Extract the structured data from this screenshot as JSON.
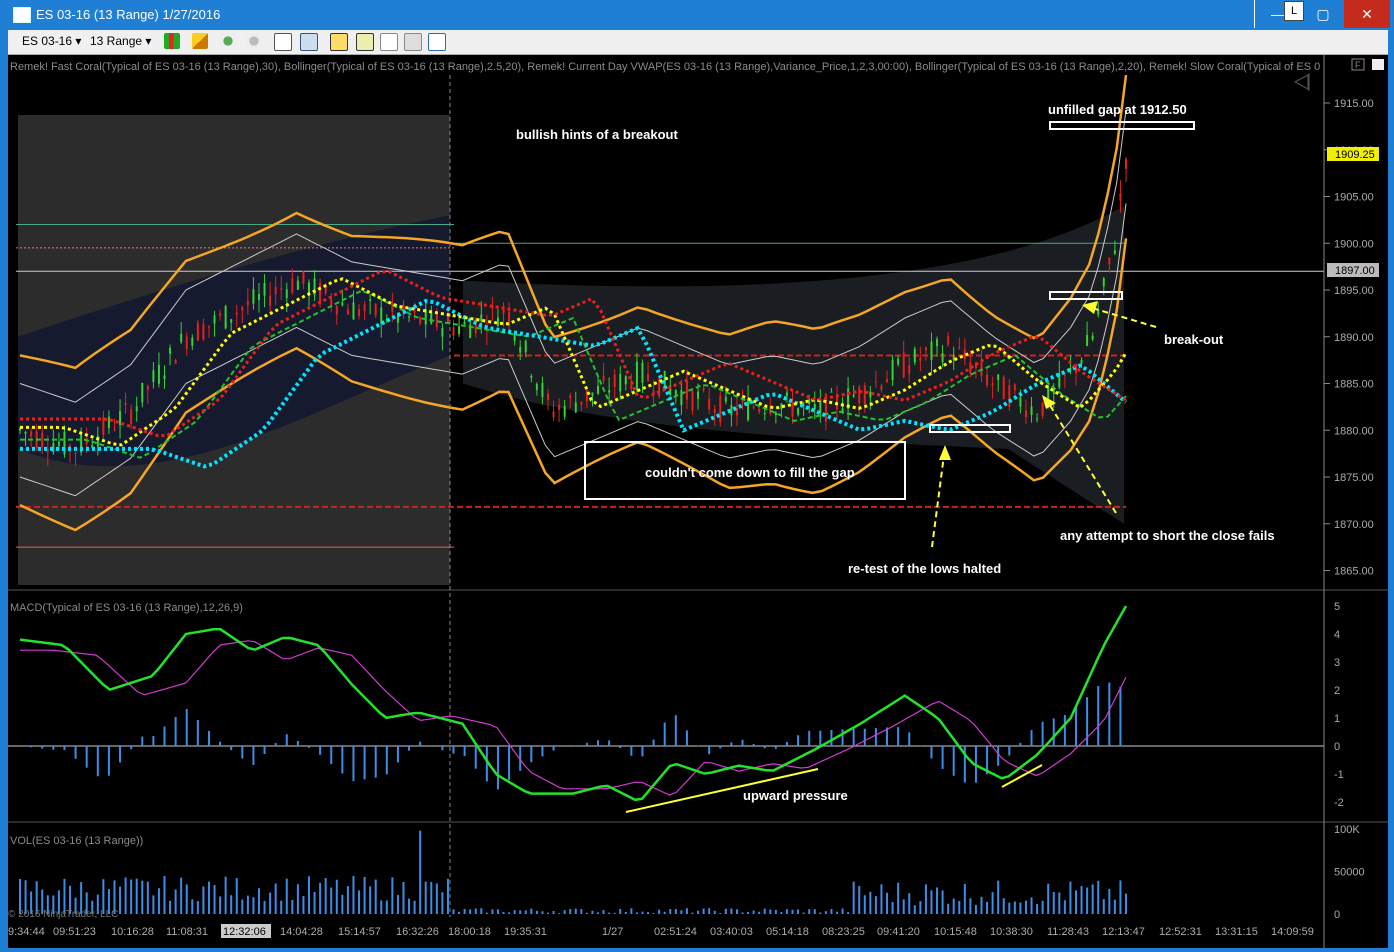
{
  "window": {
    "title": "ES 03-16 (13 Range)  1/27/2016",
    "buttons": {
      "minimize": "—",
      "lock": "L",
      "maximize": "▢",
      "close": "✕"
    }
  },
  "toolbar": {
    "instrument": "ES 03-16",
    "interval": "13 Range",
    "icons": [
      "bar-type-icon",
      "pencil-icon",
      "crosshair-icon",
      "zoom-icon",
      "data-box-icon",
      "chart-trader-icon",
      "strategies-icon",
      "properties-icon",
      "template-icon"
    ]
  },
  "indicators_label": "Remek! Fast Coral(Typical of ES 03-16 (13 Range),30), Bollinger(Typical of ES 03-16 (13 Range),2.5,20), Remek! Current Day VWAP(ES 03-16 (13 Range),Variance_Price,1,2,3,00:00), Bollinger(Typical of ES 03-16 (13 Range),2,20), Remek! Slow Coral(Typical of ES 0",
  "annotations": {
    "unfilled_gap": "unfilled gap at 1912.50",
    "bullish_hints": "bullish hints of a breakout",
    "breakout": "break-out",
    "couldnt_fill": "couldn't come down to fill the gap",
    "attempt_short": "any attempt to short the close fails",
    "retest": "re-test of the lows halted",
    "upward_pressure": "upward pressure"
  },
  "price_axis": {
    "ticks": [
      "1915.00",
      "1910.00",
      "1905.00",
      "1900.00",
      "1895.00",
      "1890.00",
      "1885.00",
      "1880.00",
      "1875.00",
      "1870.00",
      "1865.00"
    ],
    "last_price": "1909.25",
    "level_marker": "1897.00"
  },
  "macd_panel": {
    "label": "MACD(Typical of ES 03-16 (13 Range),12,26,9)",
    "ticks": [
      "5",
      "4",
      "3",
      "2",
      "1",
      "0",
      "-1",
      "-2"
    ]
  },
  "volume_panel": {
    "label": "VOL(ES 03-16 (13 Range))",
    "ticks": [
      "100K",
      "50000",
      "0"
    ]
  },
  "time_axis": {
    "labels": [
      "9:34:44",
      "09:51:23",
      "10:16:28",
      "11:08:31",
      "12:32:06",
      "14:04:28",
      "15:14:57",
      "16:32:26",
      "18:00:18",
      "19:35:31",
      "1/27",
      "02:51:24",
      "03:40:03",
      "05:14:18",
      "08:23:25",
      "09:41:20",
      "10:15:48",
      "10:38:30",
      "11:28:43",
      "12:13:47",
      "12:52:31",
      "13:31:15",
      "14:09:59"
    ],
    "highlighted": "12:32:06"
  },
  "copyright": "© 2016 NinjaTrader, LLC",
  "colors": {
    "background": "#000000",
    "bollinger_outer": "#f5a623",
    "bollinger_inner": "#cccccc",
    "fast_coral": "#00e5ff",
    "slow_coral": "#ffff00",
    "vwap": "#e8201c",
    "green_ma": "#22c22c",
    "macd_line": "#22e22c",
    "signal_line": "#d23ad2",
    "histogram": "#3b8ee8",
    "up_candle": "#34d334",
    "down_candle": "#e8201c",
    "annotation_text": "#ffffff",
    "arrow": "#ffff33"
  },
  "chart_data": {
    "type": "candlestick",
    "title": "ES 03-16 (13 Range)",
    "ylim": [
      1863,
      1917
    ],
    "approx_close_path": [
      [
        0,
        1880
      ],
      [
        0.05,
        1878
      ],
      [
        0.1,
        1882
      ],
      [
        0.15,
        1890
      ],
      [
        0.2,
        1893
      ],
      [
        0.25,
        1896
      ],
      [
        0.3,
        1893
      ],
      [
        0.35,
        1892
      ],
      [
        0.4,
        1891
      ],
      [
        0.44,
        1893
      ],
      [
        0.48,
        1882
      ],
      [
        0.52,
        1884
      ],
      [
        0.56,
        1886
      ],
      [
        0.6,
        1884
      ],
      [
        0.64,
        1882
      ],
      [
        0.68,
        1883
      ],
      [
        0.72,
        1882
      ],
      [
        0.76,
        1884
      ],
      [
        0.8,
        1887
      ],
      [
        0.84,
        1889
      ],
      [
        0.88,
        1885
      ],
      [
        0.92,
        1882
      ],
      [
        0.95,
        1886
      ],
      [
        0.97,
        1890
      ],
      [
        0.99,
        1900
      ],
      [
        1.0,
        1909.25
      ]
    ]
  }
}
